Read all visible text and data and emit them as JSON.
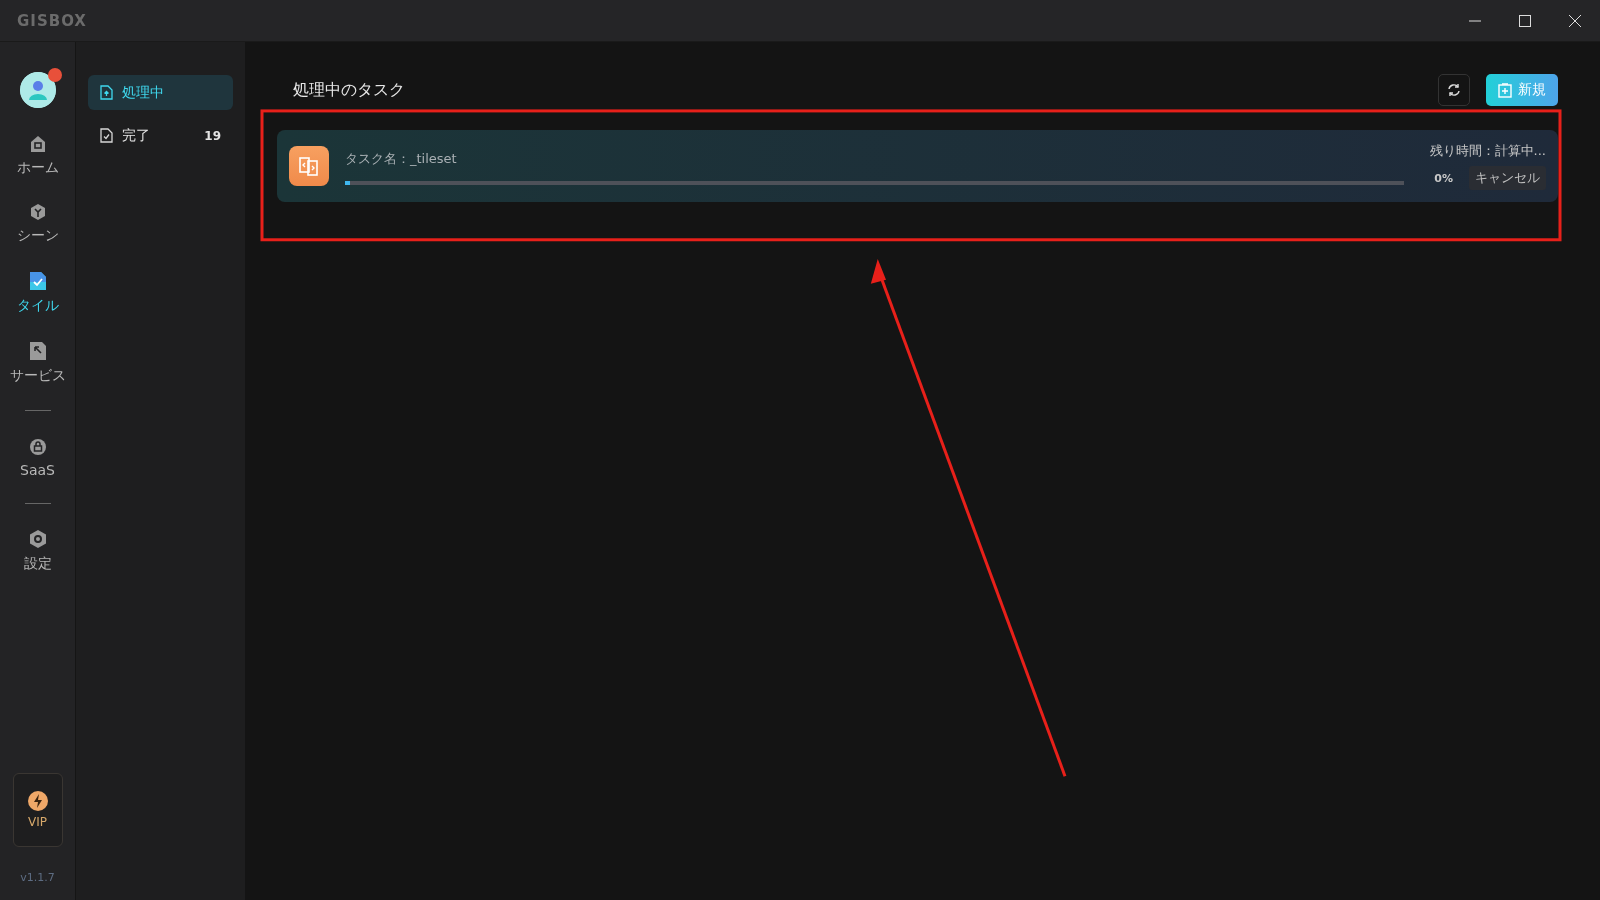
{
  "window": {
    "logo": "GISBOX"
  },
  "nav_rail": {
    "items": [
      {
        "label": "ホーム",
        "selected": false
      },
      {
        "label": "シーン",
        "selected": false
      },
      {
        "label": "タイル",
        "selected": true
      },
      {
        "label": "サービス",
        "selected": false
      },
      {
        "kind": "divider"
      },
      {
        "label": "SaaS",
        "selected": false
      },
      {
        "kind": "divider"
      },
      {
        "label": "設定",
        "selected": false
      }
    ],
    "vip": "VIP",
    "version": "v1.1.7"
  },
  "sidebar": {
    "items": [
      {
        "label": "処理中",
        "selected": true
      },
      {
        "label": "完了",
        "count": "19",
        "selected": false
      }
    ]
  },
  "main": {
    "title": "処理中のタスク",
    "new_button": "新規",
    "tasks": [
      {
        "name": "タスク名：_tileset",
        "remaining": "残り時間：計算中...",
        "percent": "0%",
        "level": 0.005,
        "cancel": "キャンセル"
      }
    ]
  }
}
